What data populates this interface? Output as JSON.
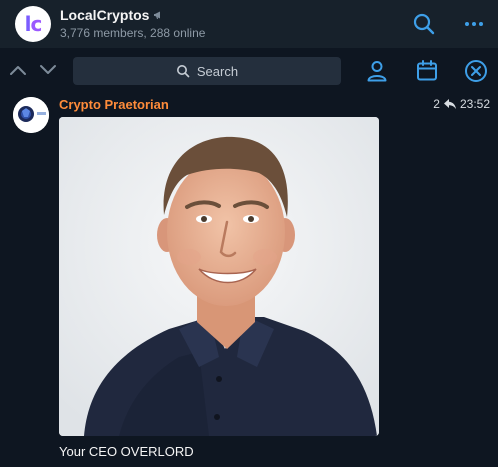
{
  "header": {
    "title": "LocalCryptos",
    "subtitle": "3,776 members, 288 online",
    "avatar_letters": "lc",
    "icons": [
      "megaphone-icon",
      "search-icon",
      "more-icon"
    ],
    "accent": "#3e9fe8"
  },
  "searchbar": {
    "placeholder": "Search",
    "icons": [
      "chevron-up-icon",
      "chevron-down-icon",
      "search-icon",
      "user-icon",
      "calendar-icon",
      "close-icon"
    ]
  },
  "message": {
    "sender": "Crypto Praetorian",
    "sender_color": "#ff8c3a",
    "reply_count": "2",
    "time": "23:52",
    "caption": "Your CEO OVERLORD"
  }
}
